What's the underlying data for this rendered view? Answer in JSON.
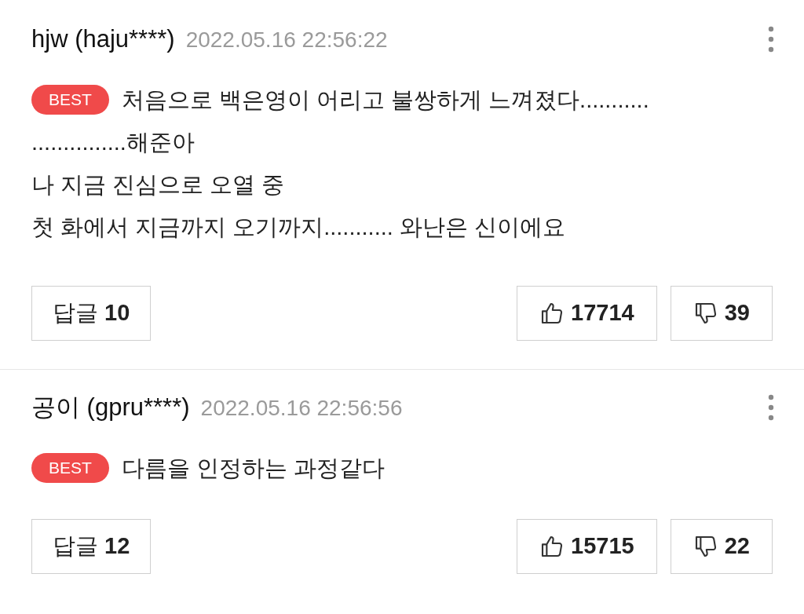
{
  "comments": [
    {
      "author": "hjw (haju****)",
      "time": "2022.05.16 22:56:22",
      "best": true,
      "badge": "BEST",
      "lines": [
        "처음으로 백은영이 어리고 불쌍하게 느껴졌다...........",
        "...............해준아",
        "나 지금 진심으로 오열 중",
        "첫 화에서 지금까지 오기까지........... 와난은 신이에요"
      ],
      "reply_label": "답글",
      "reply_count": "10",
      "likes": "17714",
      "dislikes": "39"
    },
    {
      "author": "공이 (gpru****)",
      "time": "2022.05.16 22:56:56",
      "best": true,
      "badge": "BEST",
      "lines": [
        "다름을 인정하는 과정같다"
      ],
      "reply_label": "답글",
      "reply_count": "12",
      "likes": "15715",
      "dislikes": "22"
    }
  ]
}
